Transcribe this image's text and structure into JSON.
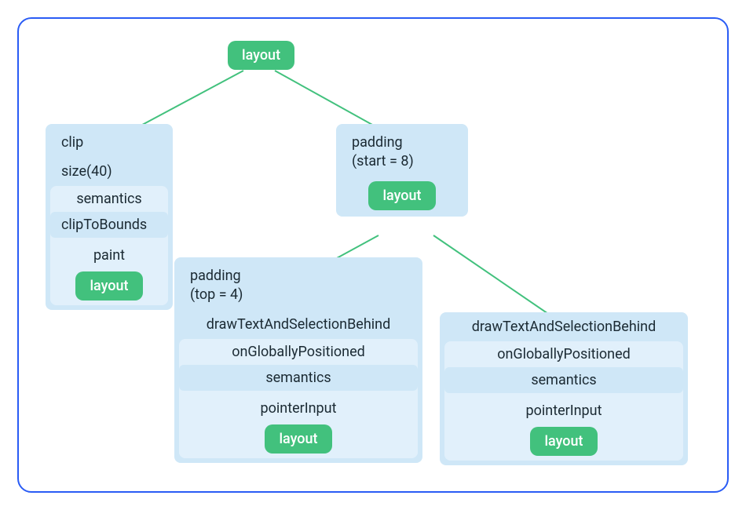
{
  "root": {
    "label": "layout"
  },
  "branchA": {
    "title": "clip",
    "rows": [
      "size(40)",
      "semantics",
      "clipToBounds",
      "paint"
    ],
    "leaf": "layout"
  },
  "branchB": {
    "title": "padding\n(start = 8)",
    "leaf": "layout"
  },
  "branchC": {
    "title": "padding\n(top = 4)",
    "rows": [
      "drawTextAndSelectionBehind",
      "onGloballyPositioned",
      "semantics",
      "pointerInput"
    ],
    "leaf": "layout"
  },
  "branchD": {
    "rows": [
      "drawTextAndSelectionBehind",
      "onGloballyPositioned",
      "semantics",
      "pointerInput"
    ],
    "leaf": "layout"
  }
}
